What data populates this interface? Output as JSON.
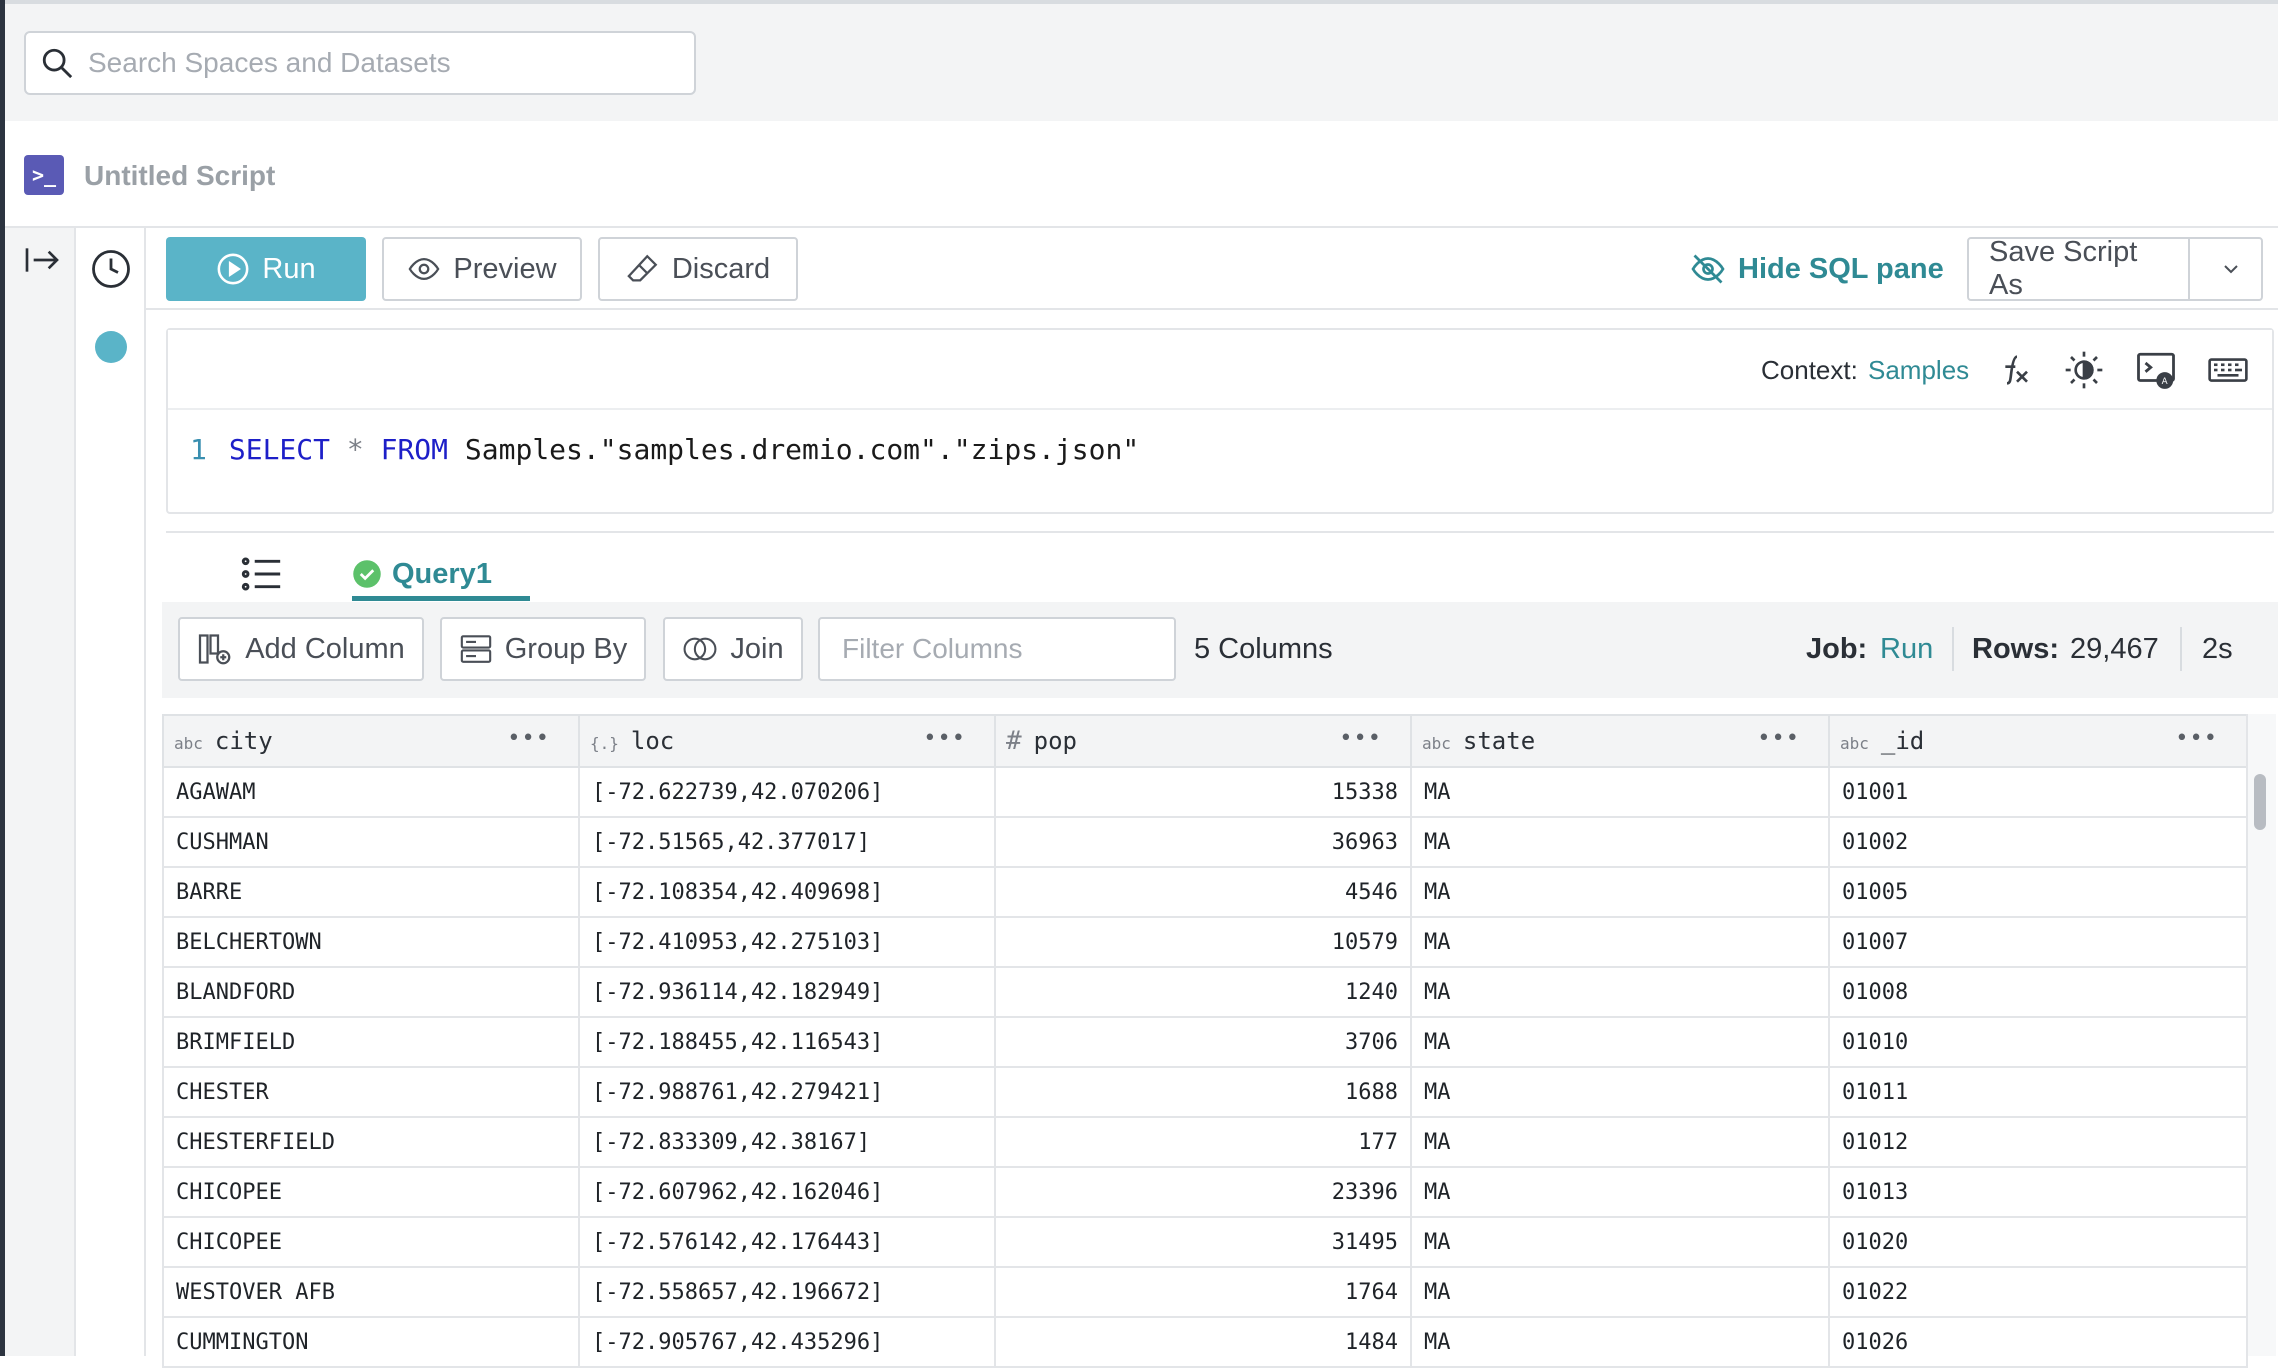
{
  "search": {
    "placeholder": "Search Spaces and Datasets"
  },
  "script": {
    "title": "Untitled Script"
  },
  "toolbar": {
    "run_label": "Run",
    "preview_label": "Preview",
    "discard_label": "Discard",
    "hide_sql_label": "Hide SQL pane",
    "save_label": "Save Script As"
  },
  "editor": {
    "context_label": "Context:",
    "context_value": "Samples",
    "line_number": "1",
    "kw_select": "SELECT",
    "star": "*",
    "kw_from": "FROM",
    "source": "Samples.\"samples.dremio.com\".\"zips.json\""
  },
  "results": {
    "tab_label": "Query1",
    "add_column_label": "Add Column",
    "group_by_label": "Group By",
    "join_label": "Join",
    "filter_placeholder": "Filter Columns",
    "columns_count": "5 Columns",
    "job_label": "Job:",
    "job_value": "Run",
    "rows_label": "Rows:",
    "rows_value": "29,467",
    "duration": "2s"
  },
  "table": {
    "columns": [
      {
        "type": "abc",
        "name": "city"
      },
      {
        "type": "{.}",
        "name": "loc"
      },
      {
        "type": "#",
        "name": "pop"
      },
      {
        "type": "abc",
        "name": "state"
      },
      {
        "type": "abc",
        "name": "_id"
      }
    ],
    "rows": [
      [
        "AGAWAM",
        "[-72.622739,42.070206]",
        "15338",
        "MA",
        "01001"
      ],
      [
        "CUSHMAN",
        "[-72.51565,42.377017]",
        "36963",
        "MA",
        "01002"
      ],
      [
        "BARRE",
        "[-72.108354,42.409698]",
        "4546",
        "MA",
        "01005"
      ],
      [
        "BELCHERTOWN",
        "[-72.410953,42.275103]",
        "10579",
        "MA",
        "01007"
      ],
      [
        "BLANDFORD",
        "[-72.936114,42.182949]",
        "1240",
        "MA",
        "01008"
      ],
      [
        "BRIMFIELD",
        "[-72.188455,42.116543]",
        "3706",
        "MA",
        "01010"
      ],
      [
        "CHESTER",
        "[-72.988761,42.279421]",
        "1688",
        "MA",
        "01011"
      ],
      [
        "CHESTERFIELD",
        "[-72.833309,42.38167]",
        "177",
        "MA",
        "01012"
      ],
      [
        "CHICOPEE",
        "[-72.607962,42.162046]",
        "23396",
        "MA",
        "01013"
      ],
      [
        "CHICOPEE",
        "[-72.576142,42.176443]",
        "31495",
        "MA",
        "01020"
      ],
      [
        "WESTOVER AFB",
        "[-72.558657,42.196672]",
        "1764",
        "MA",
        "01022"
      ],
      [
        "CUMMINGTON",
        "[-72.905767,42.435296]",
        "1484",
        "MA",
        "01026"
      ]
    ]
  },
  "colors": {
    "accent": "#2f8a94",
    "run_button": "#5ab4c8",
    "script_icon": "#5a5ab5",
    "success": "#5cc16a"
  }
}
